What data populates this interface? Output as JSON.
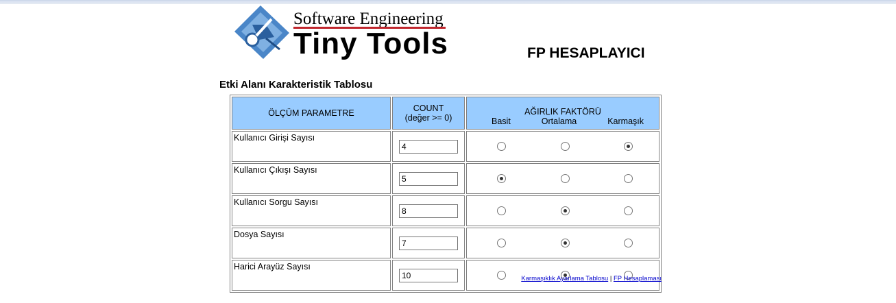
{
  "logo": {
    "line1": "Software Engineering",
    "line2": "Tiny Tools"
  },
  "page_title": "FP HESAPLAYICI",
  "section_title": "Etki Alanı Karakteristik Tablosu",
  "table": {
    "headers": {
      "param": "ÖLÇÜM PARAMETRE",
      "count_line1": "COUNT",
      "count_line2": "(değer >= 0)",
      "weight": "AĞIRLIK FAKTÖRÜ",
      "weight_basic": "Basit",
      "weight_avg": "Ortalama",
      "weight_complex": "Karmaşık"
    },
    "rows": [
      {
        "label": "Kullanıcı Girişi Sayısı",
        "count": "4",
        "selected": "complex"
      },
      {
        "label": "Kullanıcı Çıkışı Sayısı",
        "count": "5",
        "selected": "basic"
      },
      {
        "label": "Kullanıcı Sorgu Sayısı",
        "count": "8",
        "selected": "avg"
      },
      {
        "label": "Dosya Sayısı",
        "count": "7",
        "selected": "avg"
      },
      {
        "label": "Harici Arayüz Sayısı",
        "count": "10",
        "selected": "avg"
      }
    ]
  },
  "footer": {
    "link1": "Karmaşıklık Ayarlama Tablosu",
    "separator": "|",
    "link2": "FP Hesaplaması"
  },
  "colors": {
    "header_bg": "#99ccff",
    "logo_accent": "#c0262d",
    "logo_blue": "#3a7bd5"
  }
}
